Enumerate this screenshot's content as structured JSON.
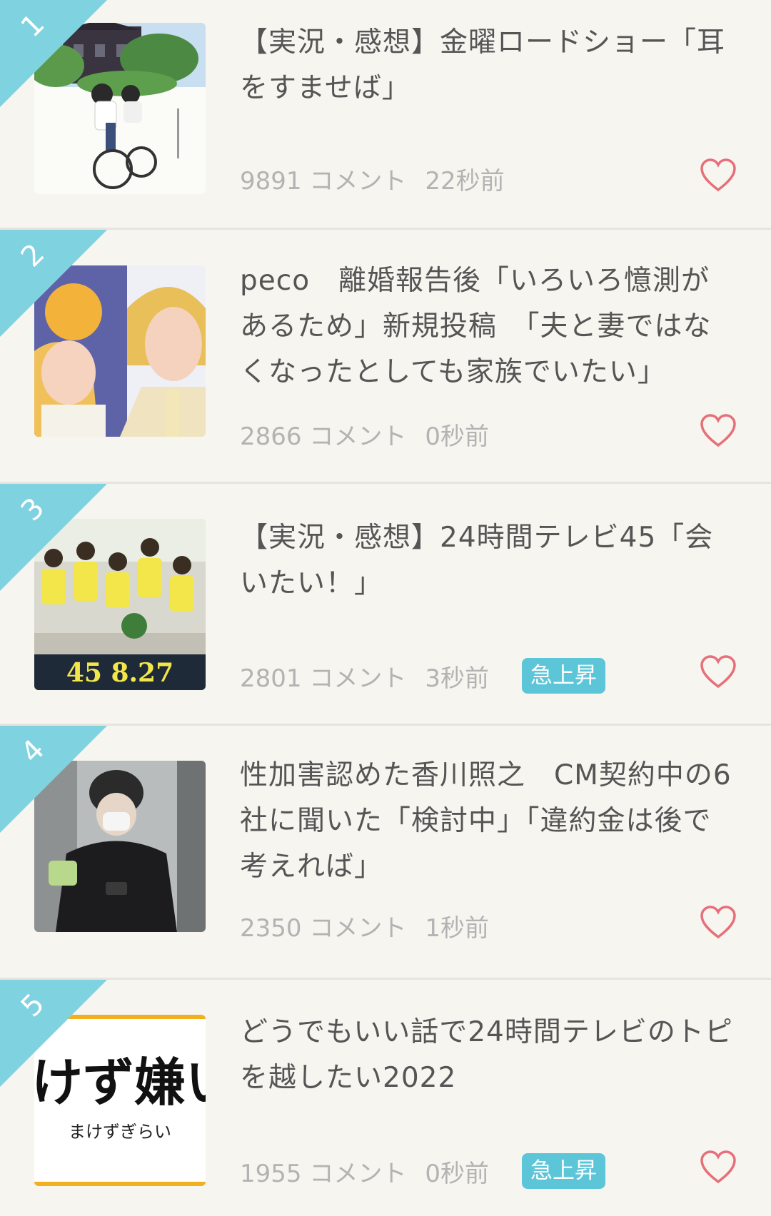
{
  "theme": {
    "accent": "#7fd2e0",
    "badge": "#5cc5d8",
    "heart": "#e76f7a",
    "background": "#f7f5ef"
  },
  "items": [
    {
      "rank": "1",
      "title": "【実況・感想】金曜ロードショー「耳をすませば」",
      "count": "9891 コメント",
      "time": "22秒前",
      "badge": "",
      "thumb": "anime-bicycle"
    },
    {
      "rank": "2",
      "title": "peco　離婚報告後「いろいろ憶測があるため」新規投稿　「夫と妻ではなくなったとしても家族でいたい」",
      "count": "2866 コメント",
      "time": "0秒前",
      "badge": "",
      "thumb": "couple-photo"
    },
    {
      "rank": "3",
      "title": "【実況・感想】24時間テレビ45「会いたい！」",
      "count": "2801 コメント",
      "time": "3秒前",
      "badge": "急上昇",
      "thumb": "group-poster",
      "thumb_text": "45 8.27"
    },
    {
      "rank": "4",
      "title": "性加害認めた香川照之　CM契約中の6社に聞いた「検討中」「違約金は後で考えれば」",
      "count": "2350 コメント",
      "time": "1秒前",
      "badge": "",
      "thumb": "masked-man-photo"
    },
    {
      "rank": "5",
      "title": "どうでもいい話で24時間テレビのトピを越したい2022",
      "count": "1955 コメント",
      "time": "0秒前",
      "badge": "急上昇",
      "thumb": "text-logo",
      "thumb_text": "けず嫌い",
      "thumb_sub": "まけずぎらい"
    }
  ]
}
